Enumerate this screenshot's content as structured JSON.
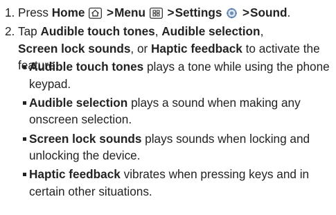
{
  "step1": {
    "number": "1.",
    "press": "Press",
    "home": "Home",
    "menu": "Menu",
    "settings": "Settings",
    "sound": "Sound",
    "separator": ">",
    "end_punct": "."
  },
  "step2": {
    "number": "2.",
    "tap": "Tap",
    "opt1": "Audible touch tones",
    "comma1": ",",
    "opt2": "Audible selection",
    "comma2": ",",
    "opt3": "Screen lock sounds",
    "or_word": ", or",
    "opt4": "Haptic feedback",
    "tail": "to activate the feature."
  },
  "bullets": [
    {
      "term": "Audible touch tones",
      "desc": "plays a tone while using the phone keypad."
    },
    {
      "term": "Audible selection",
      "desc": "plays a sound when making any onscreen selection."
    },
    {
      "term": "Screen lock sounds",
      "desc": "plays sounds when locking and unlocking the device."
    },
    {
      "term": "Haptic feedback",
      "desc": "vibrates when pressing keys and in certain other situations."
    }
  ],
  "icons": {
    "home": "home-key-icon",
    "menu": "menu-grid-key-icon",
    "settings": "settings-gear-icon"
  },
  "colors": {
    "text": "#222222",
    "settings_icon": "#6f8fb5"
  }
}
